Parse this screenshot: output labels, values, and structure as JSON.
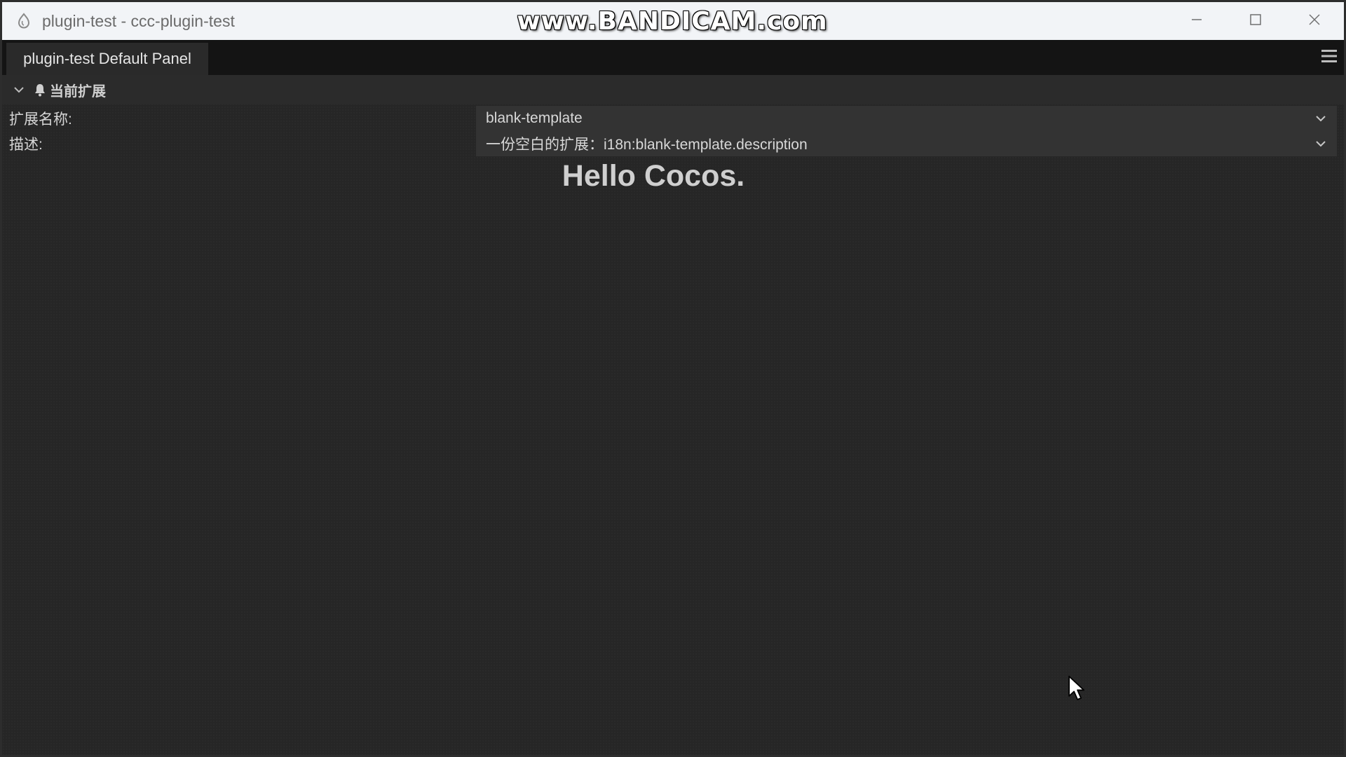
{
  "window": {
    "title": "plugin-test - ccc-plugin-test",
    "watermark": "www.BANDICAM.com"
  },
  "tabbar": {
    "active_tab": "plugin-test Default Panel",
    "menu_icon": "hamburger-menu-icon"
  },
  "section": {
    "title": "当前扩展",
    "icon": "bell-icon"
  },
  "properties": [
    {
      "label": "扩展名称:",
      "value": "blank-template"
    },
    {
      "label": "描述:",
      "value": "一份空白的扩展：i18n:blank-template.description"
    }
  ],
  "main": {
    "greeting": "Hello Cocos."
  },
  "colors": {
    "background": "#262626",
    "titlebar": "#f2f4f7",
    "tabbar": "#141414",
    "field": "#333333"
  }
}
